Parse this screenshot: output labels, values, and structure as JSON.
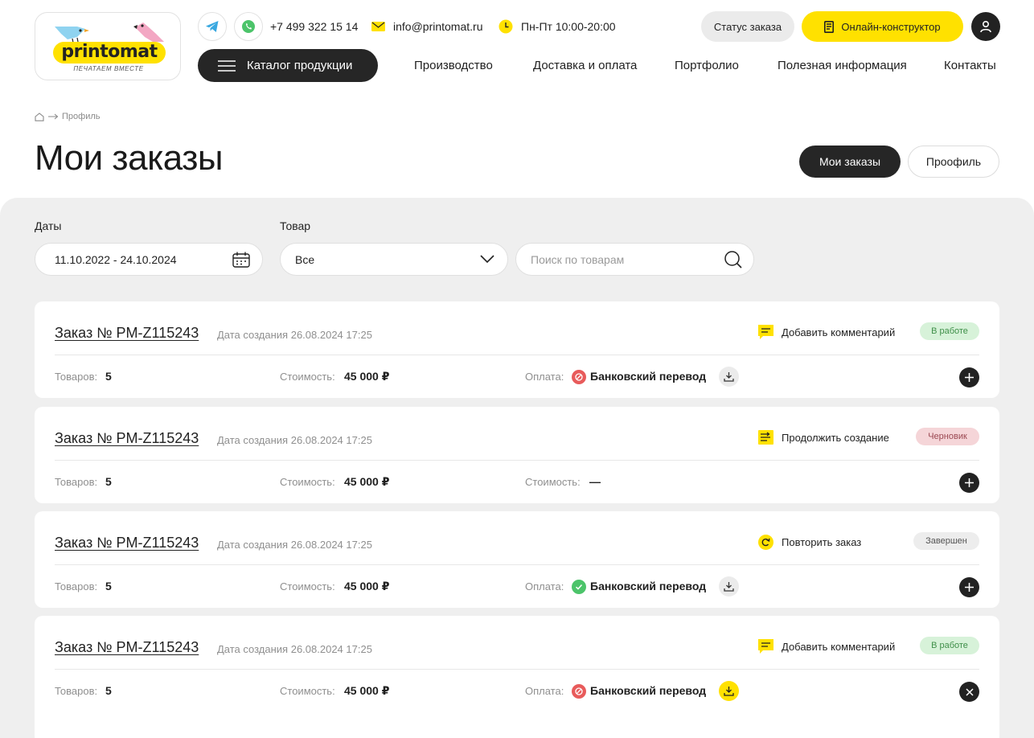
{
  "header": {
    "logo_text": "printomat",
    "logo_tagline": "ПЕЧАТАЕМ ВМЕСТЕ",
    "phone": "+7 499 322 15 14",
    "email": "info@printomat.ru",
    "hours": "Пн-Пт 10:00-20:00",
    "status_button": "Статус заказа",
    "constructor_button": "Онлайн-конструктор",
    "catalog_button": "Каталог продукции",
    "nav": [
      "Производство",
      "Доставка и оплата",
      "Портфолио",
      "Полезная информация",
      "Контакты"
    ]
  },
  "breadcrumb": {
    "current": "Профиль"
  },
  "page": {
    "title": "Мои заказы",
    "tabs": [
      "Мои заказы",
      "Проофиль"
    ]
  },
  "filters": {
    "dates_label": "Даты",
    "dates_value": "11.10.2022 - 24.10.2024",
    "product_label": "Товар",
    "product_value": "Все",
    "search_placeholder": "Поиск по товарам"
  },
  "orders": [
    {
      "number": "Заказ № PM-Z115243",
      "created": "Дата создания 26.08.2024 17:25",
      "action": "Добавить комментарий",
      "status": "В работе",
      "items_label": "Товаров:",
      "items": "5",
      "cost_label": "Стоимость:",
      "cost": "45 000 ₽",
      "pay_label": "Оплата:",
      "pay_value": "Банковский перевод"
    },
    {
      "number": "Заказ № PM-Z115243",
      "created": "Дата создания 26.08.2024 17:25",
      "action": "Продолжить создание",
      "status": "Черновик",
      "items_label": "Товаров:",
      "items": "5",
      "cost_label": "Стоимость:",
      "cost": "45 000 ₽",
      "pay_label": "Стоимость:",
      "pay_value": "—"
    },
    {
      "number": "Заказ № PM-Z115243",
      "created": "Дата создания 26.08.2024 17:25",
      "action": "Повторить заказ",
      "status": "Завершен",
      "items_label": "Товаров:",
      "items": "5",
      "cost_label": "Стоимость:",
      "cost": "45 000 ₽",
      "pay_label": "Оплата:",
      "pay_value": "Банковский перевод"
    },
    {
      "number": "Заказ № PM-Z115243",
      "created": "Дата создания 26.08.2024 17:25",
      "action": "Добавить комментарий",
      "status": "В работе",
      "items_label": "Товаров:",
      "items": "5",
      "cost_label": "Стоимость:",
      "cost": "45 000 ₽",
      "pay_label": "Оплата:",
      "pay_value": "Банковский перевод"
    }
  ],
  "colors": {
    "brand_yellow": "#ffe100",
    "dark": "#262626",
    "panel_gray": "#efefef",
    "status_work": "#d7f2d9",
    "status_draft": "#f5d5d8",
    "status_done": "#ededed",
    "pay_failed": "#e85b5b",
    "pay_ok": "#4cc46a"
  },
  "icons": {
    "telegram": "telegram-icon",
    "whatsapp": "whatsapp-icon",
    "email": "mail-icon",
    "hours": "clock-icon",
    "constructor": "book-icon",
    "user": "user-icon",
    "catalog": "menu-icon",
    "home": "home-icon",
    "calendar": "calendar-icon",
    "dropdown": "chevron-down-icon",
    "search": "search-icon",
    "comment": "comment-icon",
    "continue": "continue-icon",
    "repeat": "repeat-icon",
    "pay_failed": "failed-payment-icon",
    "pay_ok": "success-payment-icon",
    "download": "download-icon",
    "expand": "plus-icon",
    "collapse": "close-icon"
  }
}
